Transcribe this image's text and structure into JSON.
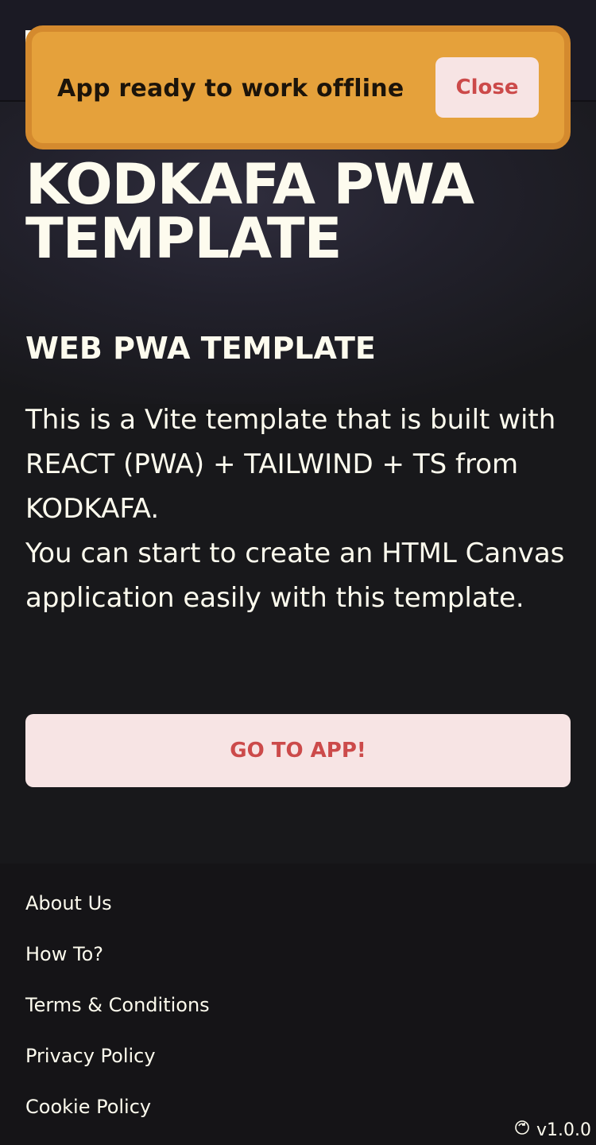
{
  "toast": {
    "message": "App ready to work offline",
    "close_label": "Close"
  },
  "hero": {
    "title": "KODKAFA PWA TEMPLATE",
    "subtitle": "WEB PWA TEMPLATE",
    "description_lines": [
      "This is a Vite template that is built with REACT (PWA) + TAILWIND + TS from KODKAFA.",
      "You can start to create an HTML Canvas application easily with this template."
    ],
    "cta_label": "GO TO APP!"
  },
  "footer": {
    "links": [
      "About Us",
      "How To?",
      "Terms & Conditions",
      "Privacy Policy",
      "Cookie Policy"
    ],
    "version": "v1.0.0"
  },
  "colors": {
    "toast_bg": "#e5a13b",
    "toast_border": "#d48a2e",
    "button_bg": "#f7e4e4",
    "button_text": "#cc4a4a",
    "page_bg": "#18181b",
    "text": "#fdfbee"
  },
  "icons": {
    "version_icon": "refresh-icon",
    "logo": "logo-icon"
  }
}
